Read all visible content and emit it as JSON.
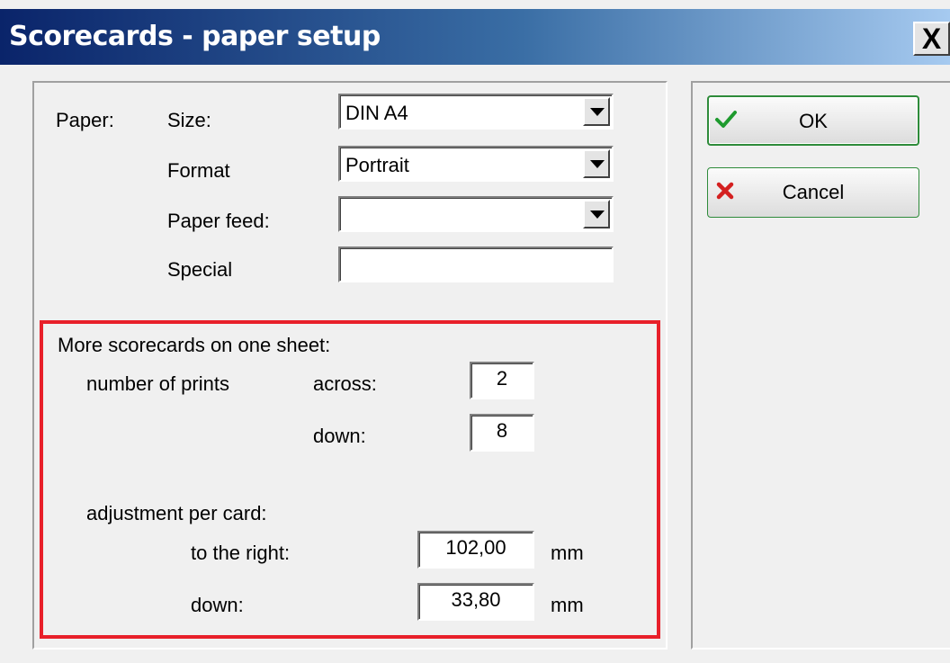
{
  "window": {
    "title": "Scorecards - paper setup",
    "close_label": "X"
  },
  "paper": {
    "group_label": "Paper:",
    "size_label": "Size:",
    "size_value": "DIN A4",
    "format_label": "Format",
    "format_value": "Portrait",
    "feed_label": "Paper feed:",
    "feed_value": "",
    "special_label": "Special",
    "special_value": ""
  },
  "more": {
    "heading": "More scorecards on one sheet:",
    "prints_label": "number of prints",
    "across_label": "across:",
    "across_value": "2",
    "down_label": "down:",
    "down_value": "8",
    "adjust_label": "adjustment per card:",
    "right_label": "to the right:",
    "right_value": "102,00",
    "right_unit": "mm",
    "adj_down_label": "down:",
    "adj_down_value": "33,80",
    "adj_down_unit": "mm"
  },
  "buttons": {
    "ok_label": "OK",
    "ok_icon": "check-icon",
    "cancel_label": "Cancel",
    "cancel_icon": "x-icon"
  },
  "colors": {
    "highlight": "#e8202a",
    "button_border": "#2e8b3a"
  }
}
